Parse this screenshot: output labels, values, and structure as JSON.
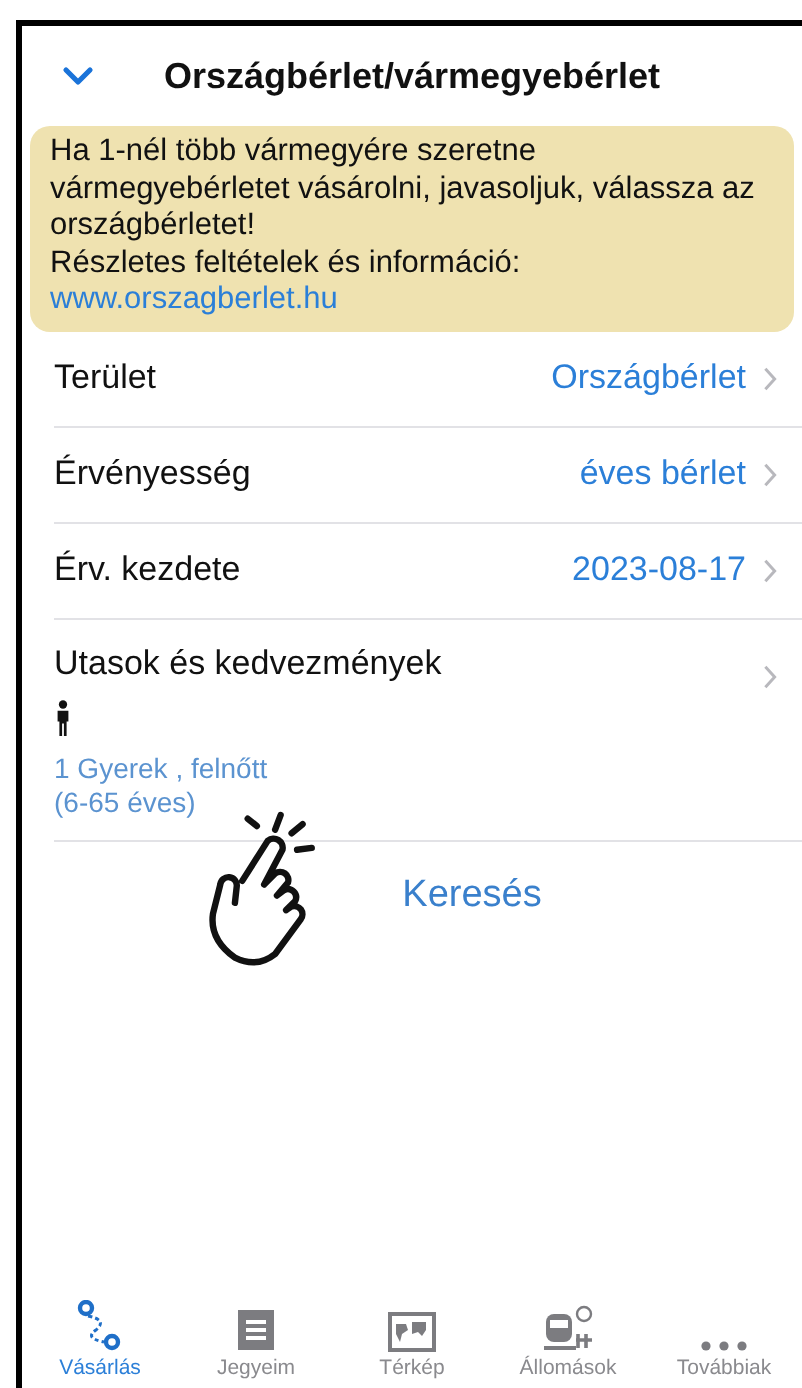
{
  "header": {
    "title": "Országbérlet/vármegyebérlet"
  },
  "notice": {
    "text": "Ha 1-nél több vármegyére szeretne vármegyebérletet vásárolni, javasoljuk, válassza az országbérletet!",
    "info": "Részletes feltételek és információ:",
    "link": "www.orszagberlet.hu"
  },
  "rows": [
    {
      "label": "Terület",
      "value": "Országbérlet"
    },
    {
      "label": "Érvényesség",
      "value": "éves bérlet"
    },
    {
      "label": "Érv. kezdete",
      "value": "2023-08-17"
    }
  ],
  "passengers": {
    "label": "Utasok és kedvezmények",
    "summary": "1 Gyerek , felnőtt",
    "detail": "(6-65 éves)"
  },
  "search_button": "Keresés",
  "tabs": [
    {
      "label": "Vásárlás",
      "kind": "route",
      "selected": true
    },
    {
      "label": "Jegyeim",
      "kind": "ticket",
      "selected": false
    },
    {
      "label": "Térkép",
      "kind": "map",
      "selected": false
    },
    {
      "label": "Állomások",
      "kind": "station",
      "selected": false
    },
    {
      "label": "Továbbiak",
      "kind": "more",
      "selected": false
    }
  ]
}
